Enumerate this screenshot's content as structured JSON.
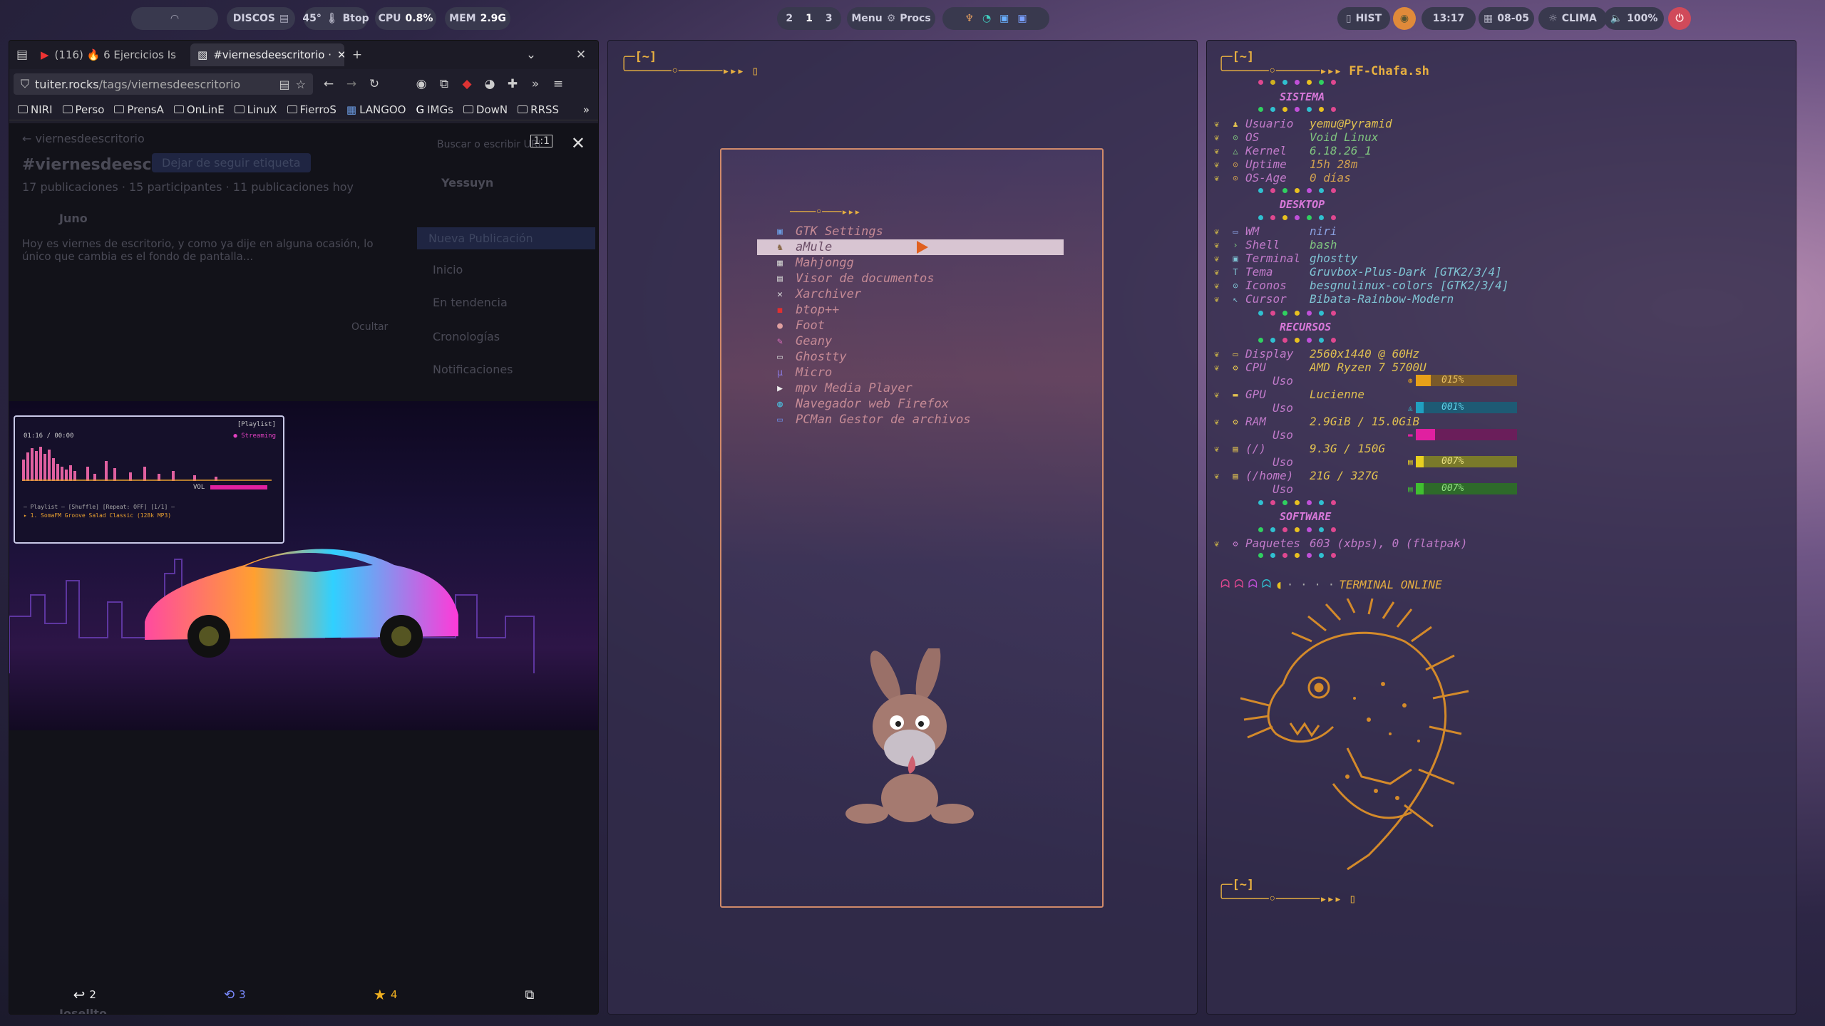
{
  "topbar": {
    "wifi_icon": "wifi-icon",
    "disks": "DISCOS",
    "temp": "45°",
    "temp_app": "Btop",
    "cpu_label": "CPU",
    "cpu_value": "0.8%",
    "mem_label": "MEM",
    "mem_value": "2.9G",
    "workspaces": [
      "2",
      "1",
      "3"
    ],
    "menu_label": "Menu",
    "procs_label": "Procs",
    "hist": "HIST",
    "time": "13:17",
    "date": "08-05",
    "weather": "CLIMA",
    "volume": "100%"
  },
  "browser": {
    "tabs": [
      {
        "label": "(116) 🔥 6 Ejercicios Is"
      },
      {
        "label": "#viernesdeescritorio ·"
      }
    ],
    "url_host": "tuiter.rocks",
    "url_path": "/tags/viernesdeescritorio",
    "bookmarks": [
      "NIRI",
      "Perso",
      "PrensA",
      "OnLinE",
      "LinuX",
      "FierroS",
      "LANGOO",
      "IMGs",
      "DowN",
      "RRSS"
    ],
    "page": {
      "back_label": "viernesdeescritorio",
      "hashtag": "#viernesdeescritorio",
      "unfollow": "Dejar de seguir etiqueta",
      "stats": "17 publicaciones · 15 participantes · 11 publicaciones hoy",
      "author": "Juno",
      "post_text": "Hoy es viernes de escritorio, y como ya dije en alguna ocasión, lo único que cambia es el fondo de pantalla...",
      "hide": "Ocultar",
      "search": "Buscar o escribir URL",
      "user": "Yessuyn",
      "new_post": "Nueva Publicación",
      "nav": [
        "Inicio",
        "En tendencia",
        "Cronologías",
        "Notificaciones"
      ],
      "author2": "Josellto"
    },
    "overlay": {
      "zoom": "1:1",
      "reply_count": "2",
      "boost_count": "3",
      "fav_count": "4"
    },
    "mini": {
      "title": "[Playlist]",
      "status": "● Streaming",
      "playlist": "— Playlist — [Shuffle] [Repeat: OFF] [1/1] —",
      "track": "▸ 1. SomaFM Groove Salad Classic (128k MP3)",
      "vol": "VOL",
      "time": "01:16 / 00:00"
    }
  },
  "terminal_mid": {
    "prompt": "[~]",
    "menu_items": [
      {
        "icon": "gtk-icon",
        "label": "GTK Settings"
      },
      {
        "icon": "amule-icon",
        "label": "aMule",
        "selected": true
      },
      {
        "icon": "mahjongg-icon",
        "label": "Mahjongg"
      },
      {
        "icon": "document-viewer-icon",
        "label": "Visor de documentos"
      },
      {
        "icon": "xarchiver-icon",
        "label": "Xarchiver"
      },
      {
        "icon": "btop-icon",
        "label": "btop++"
      },
      {
        "icon": "foot-icon",
        "label": "Foot"
      },
      {
        "icon": "geany-icon",
        "label": "Geany"
      },
      {
        "icon": "ghostty-icon",
        "label": "Ghostty"
      },
      {
        "icon": "micro-icon",
        "label": "Micro"
      },
      {
        "icon": "mpv-icon",
        "label": "mpv Media Player"
      },
      {
        "icon": "firefox-icon",
        "label": "Navegador web Firefox"
      },
      {
        "icon": "pcman-icon",
        "label": "PCMan Gestor de archivos"
      }
    ]
  },
  "terminal_right": {
    "prompt": "[~]",
    "script": "FF-Chafa.sh",
    "sections": {
      "sistema": "SISTEMA",
      "desktop": "DESKTOP",
      "recursos": "RECURSOS",
      "software": "SOFTWARE"
    },
    "rows": [
      {
        "k": "Usuario",
        "v": "yemu@Pyramid",
        "c": "#e0c050"
      },
      {
        "k": "OS",
        "v": "Void Linux",
        "c": "#7fc47f"
      },
      {
        "k": "Kernel",
        "v": "6.18.26_1",
        "c": "#7fc47f"
      },
      {
        "k": "Uptime",
        "v": "15h 28m",
        "c": "#d0a050"
      },
      {
        "k": "OS-Age",
        "v": "0 días",
        "c": "#d0a050"
      },
      {
        "k": "WM",
        "v": "niri",
        "c": "#8aa0e0"
      },
      {
        "k": "Shell",
        "v": "bash",
        "c": "#7fc47f"
      },
      {
        "k": "Terminal",
        "v": "ghostty",
        "c": "#7fc4d4"
      },
      {
        "k": "Tema",
        "v": "Gruvbox-Plus-Dark [GTK2/3/4]",
        "c": "#7fc4d4"
      },
      {
        "k": "Iconos",
        "v": "besgnulinux-colors [GTK2/3/4]",
        "c": "#7fc4d4"
      },
      {
        "k": "Cursor",
        "v": "Bibata-Rainbow-Modern",
        "c": "#7fc4d4"
      },
      {
        "k": "Display",
        "v": "2560x1440 @ 60Hz",
        "c": "#e0c050"
      },
      {
        "k": "CPU",
        "v": "AMD Ryzen 7 5700U",
        "c": "#e0c050"
      },
      {
        "k": "Uso",
        "v": "",
        "c": ""
      },
      {
        "k": "GPU",
        "v": "Lucienne",
        "c": "#e0c050"
      },
      {
        "k": "Uso",
        "v": "",
        "c": ""
      },
      {
        "k": "RAM",
        "v": "2.9GiB / 15.0GiB",
        "c": "#e0c050"
      },
      {
        "k": "Uso",
        "v": "",
        "c": ""
      },
      {
        "k": "(/)",
        "v": "9.3G / 150G",
        "c": "#e0c050"
      },
      {
        "k": "Uso",
        "v": "",
        "c": ""
      },
      {
        "k": "(/home)",
        "v": "21G / 327G",
        "c": "#e0c050"
      },
      {
        "k": "Uso",
        "v": "",
        "c": ""
      },
      {
        "k": "Paquetes",
        "v": "603 (xbps), 0 (flatpak)",
        "c": "#c07ac9"
      }
    ],
    "bars": [
      {
        "label": "015%",
        "fraction": 0.15,
        "color": "#e8a018",
        "track": "#7a5a2a",
        "text": "#e8c060"
      },
      {
        "label": "001%",
        "fraction": 0.01,
        "color": "#20a0c0",
        "track": "#1e5a74",
        "text": "#5fd0e8"
      },
      {
        "label": "",
        "fraction": 0.19,
        "color": "#e020a0",
        "track": "#6a1e5a",
        "text": "#e8a0d8"
      },
      {
        "label": "007%",
        "fraction": 0.07,
        "color": "#e8d020",
        "track": "#7a7a2a",
        "text": "#e8e080"
      },
      {
        "label": "007%",
        "fraction": 0.07,
        "color": "#40c030",
        "track": "#2e6a2a",
        "text": "#90e080"
      }
    ],
    "online": "TERMINAL ONLINE"
  }
}
